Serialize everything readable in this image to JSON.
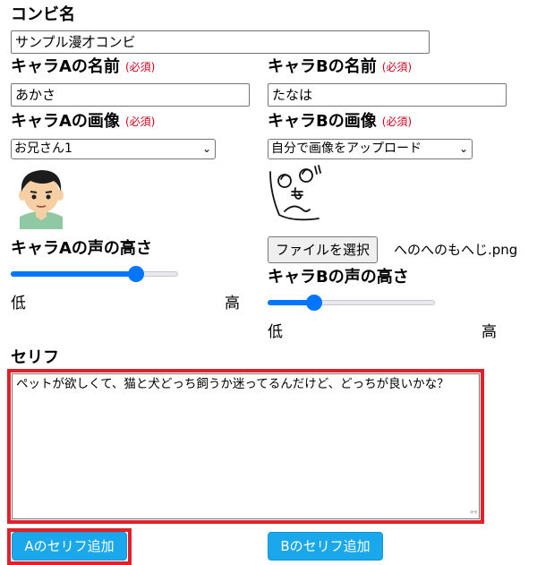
{
  "combi": {
    "label": "コンビ名",
    "value": "サンプル漫才コンビ"
  },
  "required_mark": "(必須)",
  "chara_a": {
    "name_label": "キャラAの名前",
    "name_value": "あかさ",
    "image_label": "キャラAの画像",
    "image_selected": "お兄さん1",
    "pitch_label": "キャラAの声の高さ",
    "pitch_level": 0.75,
    "low": "低",
    "high": "高"
  },
  "chara_b": {
    "name_label": "キャラBの名前",
    "name_value": "たなは",
    "image_label": "キャラBの画像",
    "image_selected": "自分で画像をアップロード",
    "file_button": "ファイルを選択",
    "file_name": "へのへのもへじ.png",
    "pitch_label": "キャラBの声の高さ",
    "pitch_level": 0.28,
    "low": "低",
    "high": "高"
  },
  "serif": {
    "label": "セリフ",
    "value": "ペットが欲しくて、猫と犬どっち飼うか迷ってるんだけど、どっちが良いかな？"
  },
  "buttons": {
    "add_a": "Aのセリフ追加",
    "add_b": "Bのセリフ追加"
  },
  "colors": {
    "accent": "#0075ff",
    "button": "#1aa7ec",
    "required": "#d0021b",
    "highlight": "#e1202a"
  }
}
